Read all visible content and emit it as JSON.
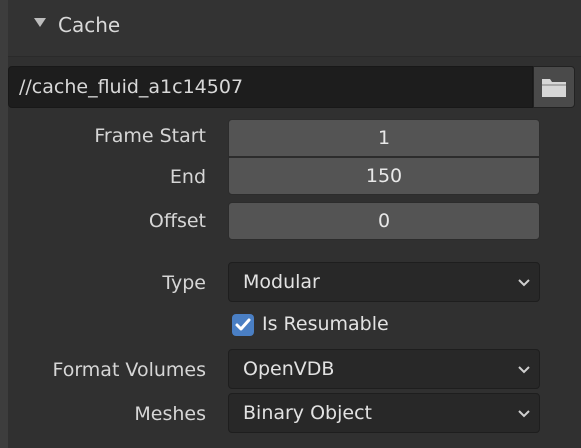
{
  "panel": {
    "title": "Cache",
    "path": "//cache_fluid_a1c14507"
  },
  "frame": {
    "start_label": "Frame Start",
    "start_value": "1",
    "end_label": "End",
    "end_value": "150",
    "offset_label": "Offset",
    "offset_value": "0"
  },
  "type": {
    "label": "Type",
    "value": "Modular"
  },
  "resumable": {
    "label": "Is Resumable",
    "checked": true
  },
  "format_volumes": {
    "label": "Format Volumes",
    "value": "OpenVDB"
  },
  "meshes": {
    "label": "Meshes",
    "value": "Binary Object"
  },
  "icons": {
    "collapse": "triangle-down-icon",
    "folder": "folder-icon",
    "dropdown": "chevron-down-icon",
    "check": "checkmark-icon"
  },
  "colors": {
    "accent": "#4a7fc4",
    "panel_bg": "#303030",
    "field_bg": "#545454",
    "dropdown_bg": "#282828"
  }
}
